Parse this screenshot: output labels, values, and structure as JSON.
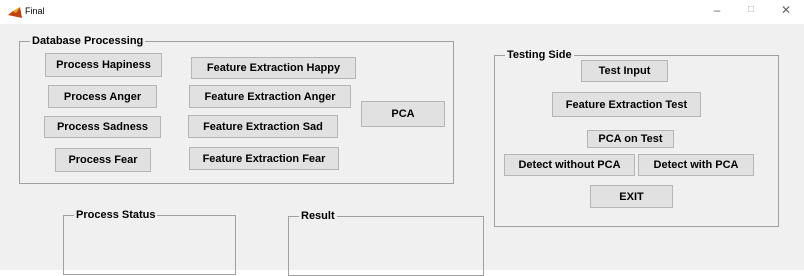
{
  "window": {
    "title": "Final",
    "minimize": "–",
    "maximize": "□",
    "close": "✕"
  },
  "database_panel": {
    "title": "Database Processing",
    "buttons": [
      "Process Hapiness",
      "Process Anger",
      "Process Sadness",
      "Process Fear",
      "Feature Extraction Happy",
      "Feature Extraction Anger",
      "Feature Extraction Sad",
      "Feature Extraction Fear",
      "PCA"
    ]
  },
  "testing_panel": {
    "title": "Testing Side",
    "buttons": [
      "Test Input",
      "Feature Extraction Test",
      "PCA on Test",
      "Detect without PCA",
      "Detect with PCA",
      "EXIT"
    ]
  },
  "status_panel": {
    "title": "Process Status"
  },
  "result_panel": {
    "title": "Result"
  }
}
